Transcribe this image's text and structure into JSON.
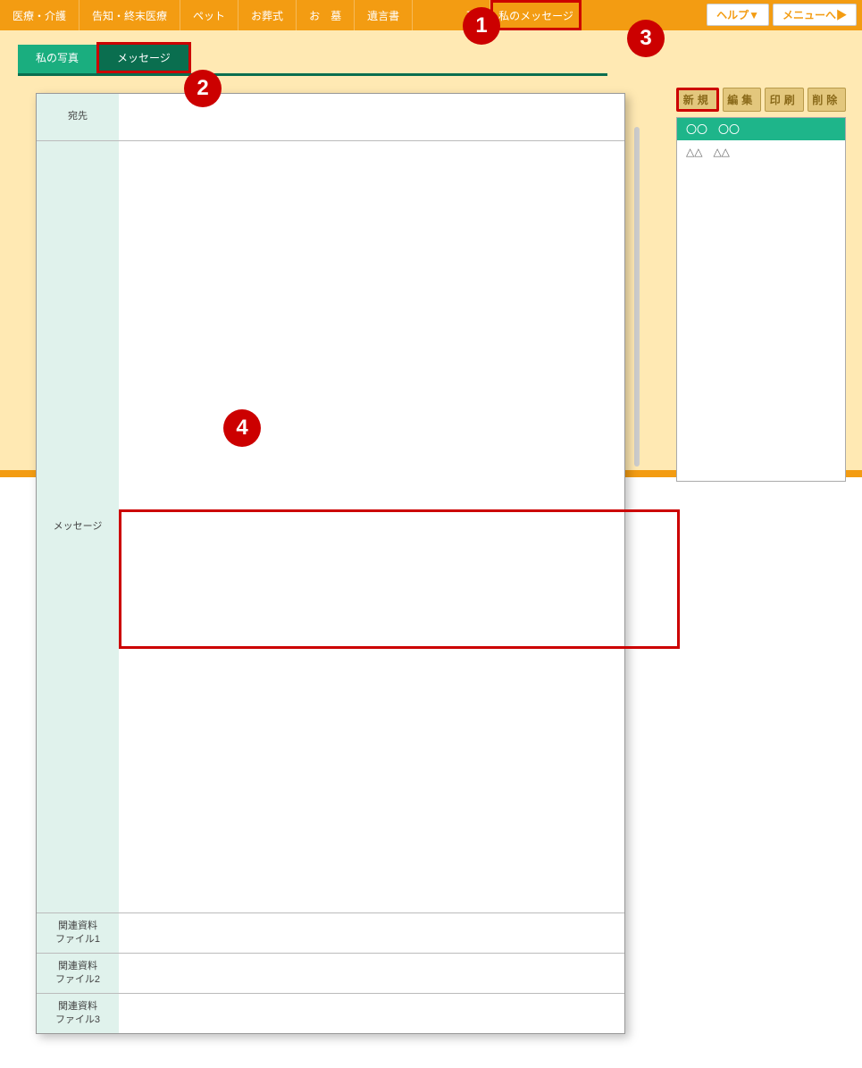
{
  "annotations": {
    "a1": "1",
    "a2": "2",
    "a3": "3",
    "a4": "4"
  },
  "topnav": {
    "items": [
      "医療・介護",
      "告知・終末医療",
      "ペット",
      "お葬式",
      "お　墓",
      "遺言書",
      "理"
    ],
    "active_item": "私のメッセージ",
    "help": "ヘルプ▼",
    "menu": "メニューへ▶"
  },
  "tabs": {
    "inactive": "私の写真",
    "active": "メッセージ"
  },
  "form": {
    "recipient_label": "宛先",
    "message_label": "メッセージ",
    "file1_label": "関連資料\nファイル1",
    "file2_label": "関連資料\nファイル2",
    "file3_label": "関連資料\nファイル3"
  },
  "sidebar": {
    "btn_new": "新規",
    "btn_edit": "編集",
    "btn_print": "印刷",
    "btn_delete": "削除",
    "items": [
      "〇〇　〇〇",
      "△△　△△"
    ]
  }
}
